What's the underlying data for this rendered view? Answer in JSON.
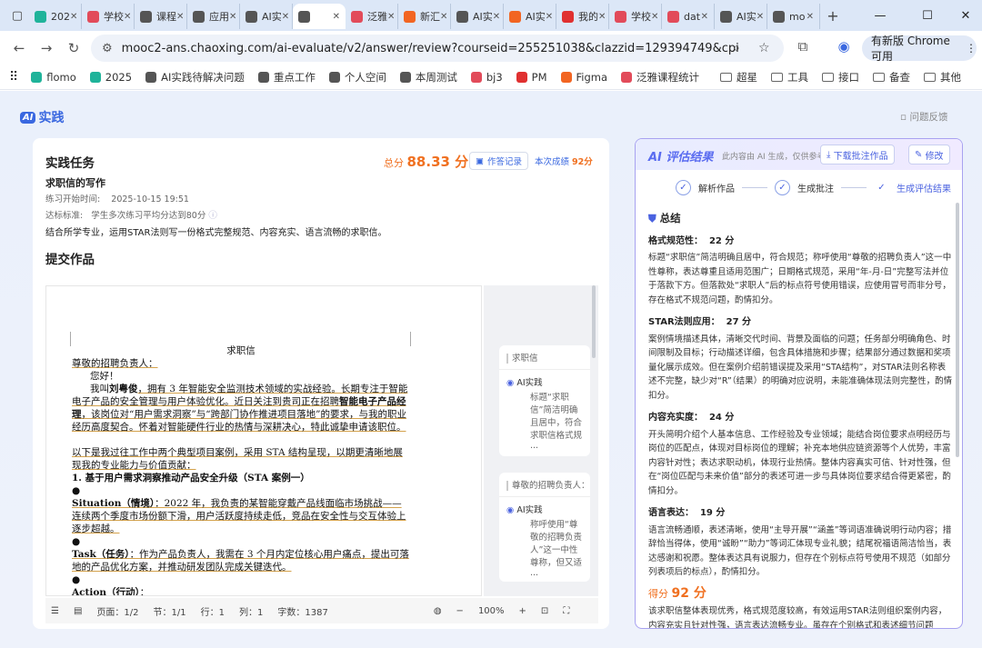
{
  "browser": {
    "tabs": [
      {
        "label": "202",
        "color": "#1fb39a"
      },
      {
        "label": "学校",
        "color": "#e24b5a"
      },
      {
        "label": "课程",
        "color": "#555"
      },
      {
        "label": "应用",
        "color": "#555"
      },
      {
        "label": "AI实",
        "color": "#555"
      },
      {
        "label": "",
        "color": "#555"
      },
      {
        "label": "泛雅",
        "color": "#e24b5a"
      },
      {
        "label": "新汇",
        "color": "#f26522"
      },
      {
        "label": "AI实",
        "color": "#555"
      },
      {
        "label": "AI实",
        "color": "#f26522"
      },
      {
        "label": "我的",
        "color": "#e03030"
      },
      {
        "label": "学校",
        "color": "#e24b5a"
      },
      {
        "label": "dat",
        "color": "#e24b5a"
      },
      {
        "label": "AI实",
        "color": "#555"
      },
      {
        "label": "mo",
        "color": "#555"
      }
    ],
    "url": "mooc2-ans.chaoxing.com/ai-evaluate/v2/answer/review?courseid=255251038&clazzid=129394749&cpi=55670471...",
    "update_label": "有新版 Chrome 可用",
    "bookmarks": [
      {
        "label": "flomo",
        "color": "#1fb39a"
      },
      {
        "label": "2025",
        "color": "#1fb39a"
      },
      {
        "label": "AI实践待解决问题",
        "color": "#555"
      },
      {
        "label": "重点工作",
        "color": "#555"
      },
      {
        "label": "个人空间",
        "color": "#555"
      },
      {
        "label": "本周测试",
        "color": "#555"
      },
      {
        "label": "bj3",
        "color": "#e24b5a"
      },
      {
        "label": "PM",
        "color": "#e03030"
      },
      {
        "label": "Figma",
        "color": "#f26522"
      },
      {
        "label": "泛雅课程统计",
        "color": "#e24b5a"
      },
      {
        "label": "超星",
        "color": "folder"
      },
      {
        "label": "工具",
        "color": "folder"
      },
      {
        "label": "接口",
        "color": "folder"
      },
      {
        "label": "备查",
        "color": "folder"
      },
      {
        "label": "其他",
        "color": "folder"
      }
    ]
  },
  "app": {
    "logo_badge": "AI",
    "logo_text": "实践",
    "feedback": "问题反馈"
  },
  "task": {
    "title": "实践任务",
    "name": "求职信的写作",
    "start_label": "练习开始时间:",
    "start_time": "2025-10-15 19:51",
    "standard_label": "达标标准:",
    "standard": "学生多次练习平均分达到80分",
    "desc": "结合所学专业，运用STAR法则写一份格式完整规范、内容充实、语言流畅的求职信。",
    "total_label": "总分",
    "total": "88.33 分",
    "record_btn": "作答记录",
    "this_label": "本次成绩",
    "this_score": "92分",
    "submit_title": "提交作品"
  },
  "doc": {
    "title": "求职信",
    "salutation": "尊敬的招聘负责人：",
    "greet": "您好！",
    "p1_a": "我叫",
    "p1_name": "刘粤俊",
    "p1_b": "，拥有 3 年智能安全监测技术领域的实战经验。长期专注于智能电子产品的安全管理与用户体验优化。近日关注到贵司正在招聘",
    "p1_role": "智能电子产品经理",
    "p1_c": "，该岗位对“用户需求洞察”与“跨部门协作推进项目落地”的要求，与我的职业经历高度契合。怀着对智能硬件行业的热情与深耕决心，特此诚挚申请该职位。",
    "p2": "以下是我过往工作中两个典型项目案例，采用 STA 结构呈现，以期更清晰地展现我的专业能力与价值贡献：",
    "h1": "1. 基于用户需求洞察推动产品安全升级（STA 案例一）",
    "bullet": "●",
    "sit_label": "Situation（情境）",
    "sit": "：2022 年，我负责的某智能穿戴产品线面临市场挑战——连续两个季度市场份额下滑，用户活跃度持续走低，竞品在安全性与交互体验上逐步超越。",
    "task_label": "Task（任务）",
    "task": "：作为产品负责人，我需在 3 个月内定位核心用户痛点，提出可落地的产品优化方案，并推动研发团队完成关键迭代。",
    "act_label": "Action（行动）",
    "act": "："
  },
  "side_cards": [
    {
      "title": "求职信",
      "author": "AI实践",
      "text": "标题“求职信”简洁明确且居中，符合求职信格式规范，能够让招聘方快速...",
      "more": "..."
    },
    {
      "title": "尊敬的招聘负责人：",
      "author": "AI实践",
      "text": "称呼使用“尊敬的招聘负责人”这一中性尊称，但又适用于不明确...",
      "more": "..."
    }
  ],
  "status": {
    "pages": "页面：1/2",
    "section": "节：1/1",
    "row": "行：1",
    "col": "列：1",
    "words": "字数：1387",
    "zoom": "100%"
  },
  "result": {
    "title": "AI 评估结果",
    "sub": "此内容由 AI 生成，仅供参考",
    "download": "下载批注作品",
    "edit": "修改",
    "steps": [
      "解析作品",
      "生成批注",
      "生成评估结果"
    ],
    "summary_title": "总结",
    "sections": [
      {
        "name": "格式规范性：",
        "score": "22 分",
        "text": "标题“求职信”简洁明确且居中，符合规范；称呼使用“尊敬的招聘负责人”这一中性尊称，表达尊重且适用范围广；日期格式规范，采用“年-月-日”完整写法并位于落款下方。但落款处“求职人”后的标点符号使用错误，应使用冒号而非分号，存在格式不规范问题，酌情扣分。"
      },
      {
        "name": "STAR法则应用：",
        "score": "27 分",
        "text": "案例情境描述具体，清晰交代时间、背景及面临的问题；任务部分明确角色、时间限制及目标；行动描述详细，包含具体措施和步骤；结果部分通过数据和奖项量化展示成效。但在案例介绍前错误提及采用“STA结构”，对STAR法则名称表述不完整，缺少对“R”（结果）的明确对应说明，未能准确体现法则完整性，酌情扣分。"
      },
      {
        "name": "内容充实度：",
        "score": "24 分",
        "text": "开头简明介绍个人基本信息、工作经验及专业领域；能结合岗位要求点明经历与岗位的匹配点，体现对目标岗位的理解；补充本地供应链资源等个人优势，丰富内容针对性；表达求职动机，体现行业热情。整体内容真实可信、针对性强，但在“岗位匹配与未来价值”部分的表述可进一步与具体岗位要求结合得更紧密，酌情扣分。"
      },
      {
        "name": "语言表达：",
        "score": "19 分",
        "text": "语言流畅通顺，表述清晰，使用“主导开展”“涵盖”等词语准确说明行动内容；措辞恰当得体，使用“诚盼”“助力”等词汇体现专业礼貌；结尾祝福语简洁恰当，表达感谢和祝愿。整体表达具有说服力，但存在个别标点符号使用不规范（如部分列表项后的标点），酌情扣分。"
      }
    ],
    "score_label": "得分",
    "score": "92 分",
    "final": "该求职信整体表现优秀，格式规范度较高，有效运用STAR法则组织案例内容，内容充实且针对性强，语言表达流畅专业。虽存在个别格式和表述细节问题"
  }
}
